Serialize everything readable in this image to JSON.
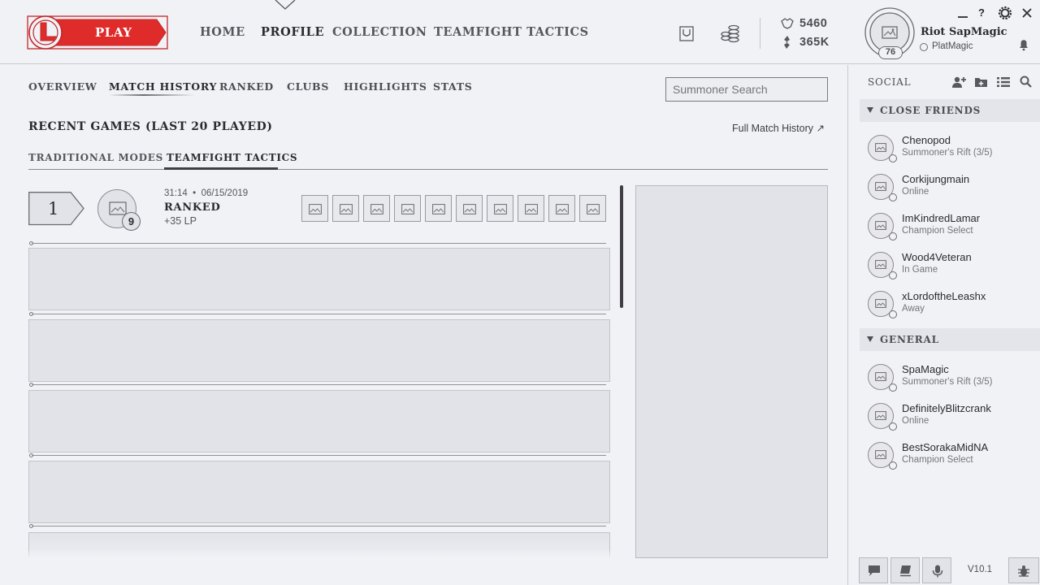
{
  "play_label": "PLAY",
  "nav": {
    "home": "HOME",
    "profile": "PROFILE",
    "collection": "COLLECTION",
    "tft": "TEAMFIGHT TACTICS"
  },
  "currency": {
    "blue_essence": "5460",
    "riot_points": "365K"
  },
  "profile": {
    "name": "Riot SapMagic",
    "level": "76",
    "status_name": "PlatMagic"
  },
  "window_controls": [
    "minimize",
    "help",
    "settings",
    "close"
  ],
  "subnav": {
    "overview": "OVERVIEW",
    "match_history": "MATCH HISTORY",
    "ranked": "RANKED",
    "clubs": "CLUBS",
    "highlights": "HIGHLIGHTS",
    "stats": "STATS"
  },
  "search": {
    "placeholder": "Summoner Search"
  },
  "recent": {
    "title": "RECENT GAMES (LAST 20 PLAYED)",
    "full_history": "Full Match History ↗"
  },
  "mode_tabs": {
    "traditional": "TRADITIONAL MODES",
    "tft": "TEAMFIGHT TACTICS"
  },
  "game": {
    "placement": "1",
    "champ_level": "9",
    "meta": "31:14  •  06/15/2019",
    "queue": "RANKED",
    "lp": "+35 LP"
  },
  "social": {
    "title": "SOCIAL",
    "groups": {
      "close_friends": "CLOSE FRIENDS",
      "general": "GENERAL"
    },
    "close_friends": [
      {
        "name": "Chenopod",
        "status": "Summoner's Rift (3/5)"
      },
      {
        "name": "Corkijungmain",
        "status": "Online"
      },
      {
        "name": "ImKindredLamar",
        "status": "Champion Select"
      },
      {
        "name": "Wood4Veteran",
        "status": "In Game"
      },
      {
        "name": "xLordoftheLeashx",
        "status": "Away"
      }
    ],
    "general": [
      {
        "name": "SpaMagic",
        "status": "Summoner's Rift (3/5)"
      },
      {
        "name": "DefinitelyBlitzcrank",
        "status": "Online"
      },
      {
        "name": "BestSorakaMidNA",
        "status": "Champion Select"
      }
    ]
  },
  "version": "V10.1",
  "colors": {
    "play_red": "#e02b2b",
    "background": "#f1f2f6",
    "placeholder_gray": "#e2e3e8"
  }
}
